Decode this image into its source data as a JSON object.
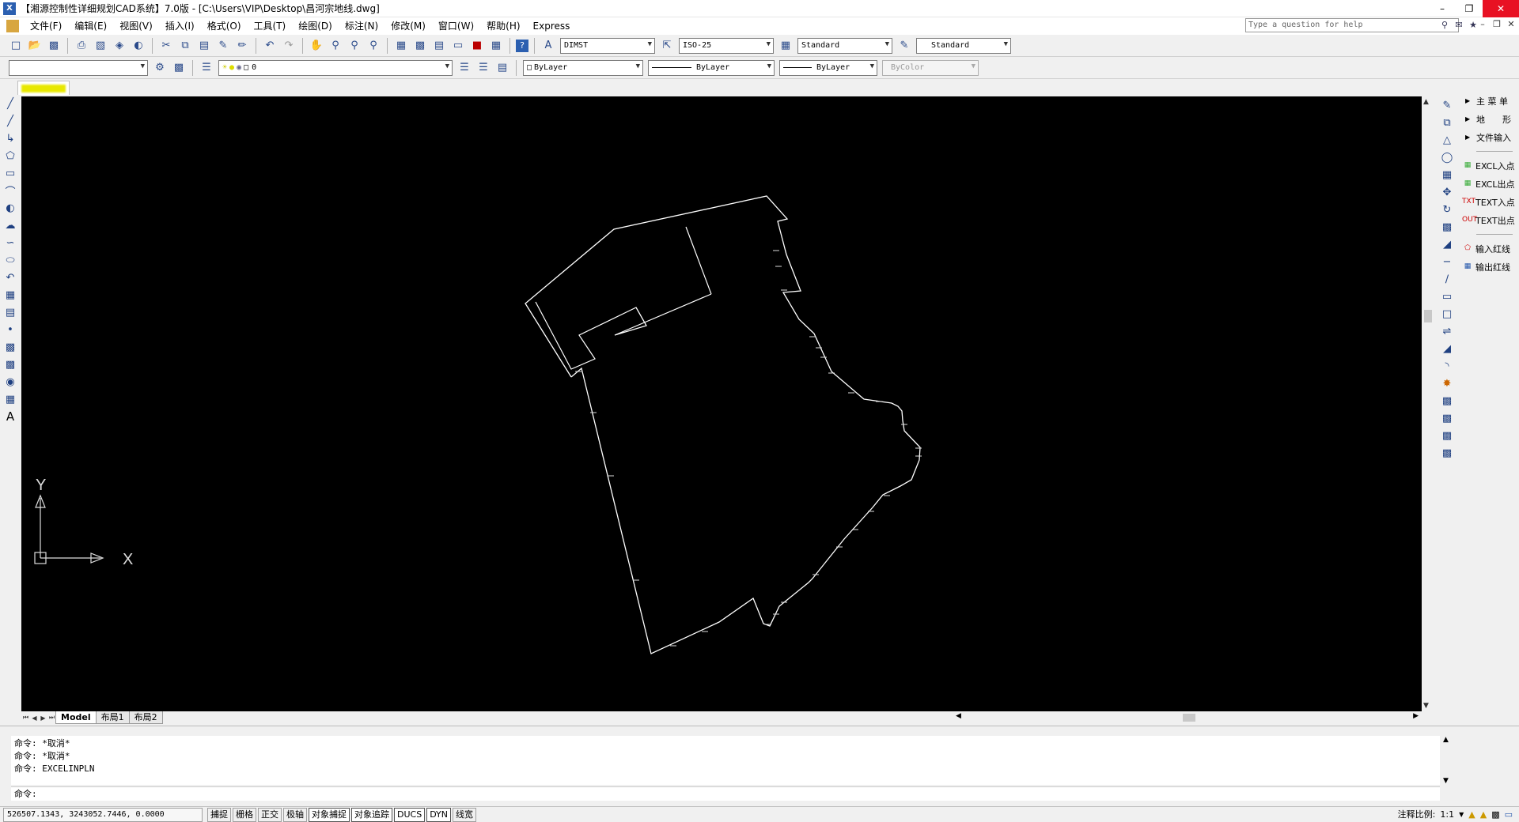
{
  "window": {
    "title": "【湘源控制性详细规划CAD系统】7.0版 - [C:\\Users\\VIP\\Desktop\\昌河宗地线.dwg]",
    "app_icon_text": "X"
  },
  "menu": [
    "文件(F)",
    "编辑(E)",
    "视图(V)",
    "插入(I)",
    "格式(O)",
    "工具(T)",
    "绘图(D)",
    "标注(N)",
    "修改(M)",
    "窗口(W)",
    "帮助(H)",
    "Express"
  ],
  "help": {
    "placeholder": "Type a question for help"
  },
  "styles_toolbar": {
    "text_style": "DIMST",
    "dim_style": "ISO-25",
    "table_style": "Standard",
    "multileader_style": "Standard"
  },
  "layers_toolbar": {
    "workspace": "",
    "current_layer": "0"
  },
  "properties_toolbar": {
    "color": "ByLayer",
    "linetype": "ByLayer",
    "lineweight": "ByLayer",
    "plot_style": "ByColor"
  },
  "layout_tabs": [
    "Model",
    "布局1",
    "布局2"
  ],
  "ucs": {
    "x_label": "X",
    "y_label": "Y"
  },
  "custom_menu": {
    "groups": [
      {
        "label": "主 菜 单"
      },
      {
        "label": "地　　形"
      },
      {
        "label": "文件输入"
      }
    ],
    "items": [
      {
        "label": "EXCL入点",
        "icon": "excel-in-icon"
      },
      {
        "label": "EXCL出点",
        "icon": "excel-out-icon"
      },
      {
        "label": "TEXT入点",
        "icon": "text-in-icon",
        "badge": "TXT"
      },
      {
        "label": "TEXT出点",
        "icon": "text-out-icon",
        "badge": "OUT"
      }
    ],
    "items2": [
      {
        "label": "输入红线",
        "icon": "input-redline-icon"
      },
      {
        "label": "输出红线",
        "icon": "output-redline-icon"
      }
    ]
  },
  "command": {
    "history": [
      "命令: *取消*",
      "命令: *取消*",
      "命令: EXCELINPLN"
    ],
    "prompt": "命令:"
  },
  "status": {
    "coords": "526507.1343,  3243052.7446,  0.0000",
    "toggles": [
      {
        "label": "捕捉",
        "on": false
      },
      {
        "label": "栅格",
        "on": false
      },
      {
        "label": "正交",
        "on": false
      },
      {
        "label": "极轴",
        "on": false
      },
      {
        "label": "对象捕捉",
        "on": true
      },
      {
        "label": "对象追踪",
        "on": true
      },
      {
        "label": "DUCS",
        "on": true
      },
      {
        "label": "DYN",
        "on": true
      },
      {
        "label": "线宽",
        "on": false
      }
    ],
    "annotation_scale_label": "注释比例:",
    "annotation_scale_value": "1:1"
  },
  "colors": {
    "canvas_bg": "#000000",
    "drawing_line": "#ffffff",
    "close_button": "#e81123"
  }
}
